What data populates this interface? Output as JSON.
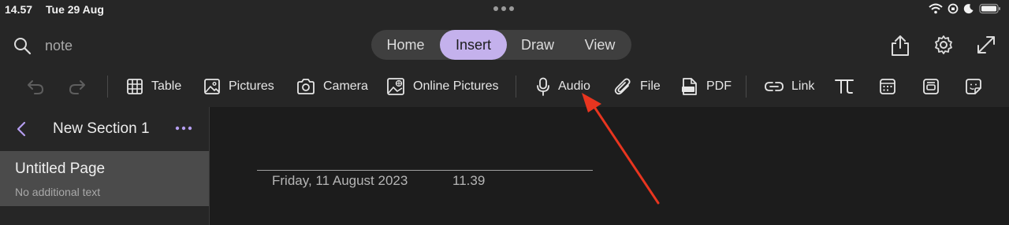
{
  "status": {
    "time": "14.57",
    "date": "Tue 29 Aug"
  },
  "search": {
    "text": "note"
  },
  "tabs": [
    {
      "label": "Home"
    },
    {
      "label": "Insert"
    },
    {
      "label": "Draw"
    },
    {
      "label": "View"
    }
  ],
  "active_tab": "Insert",
  "ribbon": {
    "table": "Table",
    "pictures": "Pictures",
    "camera": "Camera",
    "online_pictures": "Online Pictures",
    "audio": "Audio",
    "file": "File",
    "pdf": "PDF",
    "link": "Link"
  },
  "sidebar": {
    "section_title": "New Section 1",
    "pages": [
      {
        "title": "Untitled Page",
        "subtitle": "No additional text"
      }
    ]
  },
  "page": {
    "date": "Friday, 11 August 2023",
    "time": "11.39"
  },
  "colors": {
    "accent": "#c4b1ec",
    "annotation_arrow": "#e8351f"
  }
}
